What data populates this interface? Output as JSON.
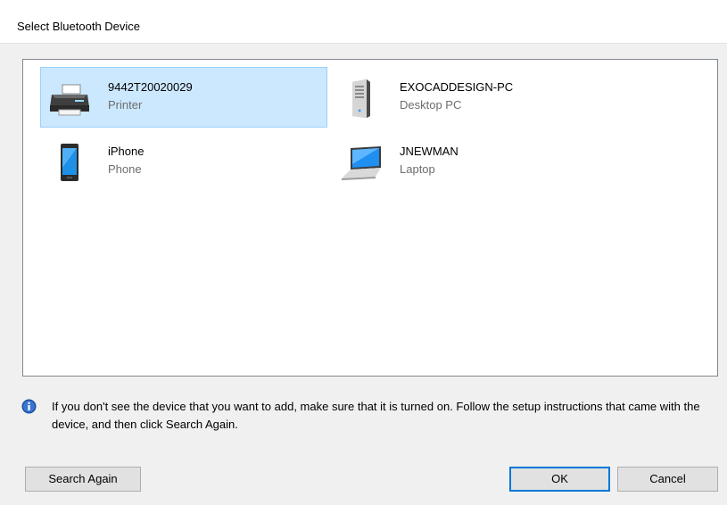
{
  "window": {
    "title": "Select Bluetooth Device"
  },
  "devices": [
    {
      "name": "9442T20020029",
      "type": "Printer",
      "icon": "printer-icon",
      "selected": true
    },
    {
      "name": "EXOCADDESIGN-PC",
      "type": "Desktop PC",
      "icon": "desktop-pc-icon",
      "selected": false
    },
    {
      "name": "iPhone",
      "type": "Phone",
      "icon": "phone-icon",
      "selected": false
    },
    {
      "name": "JNEWMAN",
      "type": "Laptop",
      "icon": "laptop-icon",
      "selected": false
    }
  ],
  "info": {
    "icon": "info-icon",
    "text": "If you don't see the device that you want to add, make sure that it is turned on. Follow the setup instructions that came with the device, and then click Search Again."
  },
  "buttons": {
    "search_again": "Search Again",
    "ok": "OK",
    "cancel": "Cancel"
  },
  "colors": {
    "selection": "#cce8ff",
    "selection_border": "#99d1ff",
    "accent": "#0078d7",
    "info_icon": "#1c4fa1"
  }
}
